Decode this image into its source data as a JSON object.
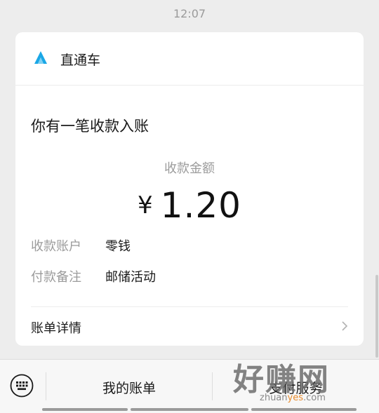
{
  "status_time": "12:07",
  "card": {
    "app_name": "直通车",
    "headline": "你有一笔收款入账",
    "amount_label": "收款金额",
    "currency": "¥",
    "amount": "1.20",
    "rows": [
      {
        "key": "收款账户",
        "value": "零钱"
      },
      {
        "key": "付款备注",
        "value": "邮储活动"
      }
    ],
    "detail_label": "账单详情"
  },
  "bottom_menu": {
    "bill_label": "我的账单",
    "pay_label": "支付服务"
  },
  "watermark": {
    "main": "好赚网",
    "url_prefix": "zhuan",
    "url_highlight": "yes",
    "url_suffix": ".com"
  },
  "colors": {
    "logo_blue": "#1aa7e6",
    "watermark_orange": "#e88a2a"
  }
}
